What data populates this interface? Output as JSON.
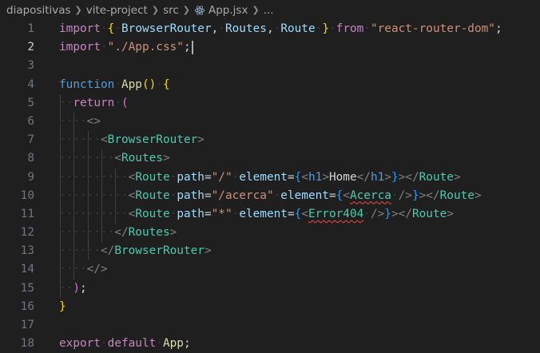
{
  "breadcrumb": {
    "segments": [
      "diapositivas",
      "vite-project",
      "src"
    ],
    "file": "App.jsx",
    "more": "..."
  },
  "editor": {
    "language": "javascriptreact",
    "active_line": 2,
    "cursor_line": 2,
    "error_lines": [
      10,
      11
    ],
    "lines": [
      {
        "n": "1",
        "tokens": [
          [
            "kw",
            "import"
          ],
          [
            "ws",
            "·"
          ],
          [
            "br1",
            "{"
          ],
          [
            "ws",
            "·"
          ],
          [
            "var",
            "BrowserRouter"
          ],
          [
            "op",
            ","
          ],
          [
            "ws",
            "·"
          ],
          [
            "var",
            "Routes"
          ],
          [
            "op",
            ","
          ],
          [
            "ws",
            "·"
          ],
          [
            "var",
            "Route"
          ],
          [
            "ws",
            "·"
          ],
          [
            "br1",
            "}"
          ],
          [
            "ws",
            "·"
          ],
          [
            "kw",
            "from"
          ],
          [
            "ws",
            "·"
          ],
          [
            "str",
            "\"react-router-dom\""
          ],
          [
            "op",
            ";"
          ]
        ]
      },
      {
        "n": "2",
        "tokens": [
          [
            "kw",
            "import"
          ],
          [
            "ws",
            "·"
          ],
          [
            "str",
            "\"./App.css\""
          ],
          [
            "op",
            ";"
          ]
        ]
      },
      {
        "n": "3",
        "tokens": []
      },
      {
        "n": "4",
        "tokens": [
          [
            "tagh",
            "function"
          ],
          [
            "ws",
            "·"
          ],
          [
            "fn",
            "App"
          ],
          [
            "br1",
            "()"
          ],
          [
            "ws",
            "·"
          ],
          [
            "br1",
            "{"
          ]
        ]
      },
      {
        "n": "5",
        "tokens": [
          [
            "ws",
            "··"
          ],
          [
            "kw",
            "return"
          ],
          [
            "ws",
            "·"
          ],
          [
            "br2",
            "("
          ]
        ]
      },
      {
        "n": "6",
        "tokens": [
          [
            "ws",
            "····"
          ],
          [
            "tagbr",
            "<>"
          ]
        ]
      },
      {
        "n": "7",
        "tokens": [
          [
            "ws",
            "······"
          ],
          [
            "tagbr",
            "<"
          ],
          [
            "tag",
            "BrowserRouter"
          ],
          [
            "tagbr",
            ">"
          ]
        ]
      },
      {
        "n": "8",
        "tokens": [
          [
            "ws",
            "········"
          ],
          [
            "tagbr",
            "<"
          ],
          [
            "tag",
            "Routes"
          ],
          [
            "tagbr",
            ">"
          ]
        ]
      },
      {
        "n": "9",
        "tokens": [
          [
            "ws",
            "··········"
          ],
          [
            "tagbr",
            "<"
          ],
          [
            "tag",
            "Route"
          ],
          [
            "ws",
            "·"
          ],
          [
            "attr",
            "path"
          ],
          [
            "op",
            "="
          ],
          [
            "str",
            "\"/\""
          ],
          [
            "ws",
            "·"
          ],
          [
            "attr",
            "element"
          ],
          [
            "op",
            "="
          ],
          [
            "br3",
            "{"
          ],
          [
            "tagbr",
            "<"
          ],
          [
            "tagh",
            "h1"
          ],
          [
            "tagbr",
            ">"
          ],
          [
            "txt",
            "Home"
          ],
          [
            "tagbr",
            "</"
          ],
          [
            "tagh",
            "h1"
          ],
          [
            "tagbr",
            ">"
          ],
          [
            "br3",
            "}"
          ],
          [
            "tagbr",
            "></"
          ],
          [
            "tag",
            "Route"
          ],
          [
            "tagbr",
            ">"
          ]
        ]
      },
      {
        "n": "10",
        "tokens": [
          [
            "ws",
            "··········"
          ],
          [
            "tagbr",
            "<"
          ],
          [
            "tag",
            "Route"
          ],
          [
            "ws",
            "·"
          ],
          [
            "attr",
            "path"
          ],
          [
            "op",
            "="
          ],
          [
            "str",
            "\"/acerca\""
          ],
          [
            "ws",
            "·"
          ],
          [
            "attr",
            "element"
          ],
          [
            "op",
            "="
          ],
          [
            "br3",
            "{"
          ],
          [
            "tagbr",
            "<"
          ],
          [
            "tag squig",
            "Acerca"
          ],
          [
            "ws",
            "·"
          ],
          [
            "tagbr",
            "/>"
          ],
          [
            "br3",
            "}"
          ],
          [
            "tagbr",
            "></"
          ],
          [
            "tag",
            "Route"
          ],
          [
            "tagbr",
            ">"
          ]
        ]
      },
      {
        "n": "11",
        "tokens": [
          [
            "ws",
            "··········"
          ],
          [
            "tagbr",
            "<"
          ],
          [
            "tag",
            "Route"
          ],
          [
            "ws",
            "·"
          ],
          [
            "attr",
            "path"
          ],
          [
            "op",
            "="
          ],
          [
            "str",
            "\"*\""
          ],
          [
            "ws",
            "·"
          ],
          [
            "attr",
            "element"
          ],
          [
            "op",
            "="
          ],
          [
            "br3",
            "{"
          ],
          [
            "tagbr",
            "<"
          ],
          [
            "tag squig",
            "Error404"
          ],
          [
            "ws",
            "·"
          ],
          [
            "tagbr",
            "/>"
          ],
          [
            "br3",
            "}"
          ],
          [
            "tagbr",
            "></"
          ],
          [
            "tag",
            "Route"
          ],
          [
            "tagbr",
            ">"
          ]
        ]
      },
      {
        "n": "12",
        "tokens": [
          [
            "ws",
            "········"
          ],
          [
            "tagbr",
            "</"
          ],
          [
            "tag",
            "Routes"
          ],
          [
            "tagbr",
            ">"
          ]
        ]
      },
      {
        "n": "13",
        "tokens": [
          [
            "ws",
            "······"
          ],
          [
            "tagbr",
            "</"
          ],
          [
            "tag",
            "BrowserRouter"
          ],
          [
            "tagbr",
            ">"
          ]
        ]
      },
      {
        "n": "14",
        "tokens": [
          [
            "ws",
            "····"
          ],
          [
            "tagbr",
            "</>"
          ]
        ]
      },
      {
        "n": "15",
        "tokens": [
          [
            "ws",
            "··"
          ],
          [
            "br2",
            ")"
          ],
          [
            "op",
            ";"
          ]
        ]
      },
      {
        "n": "16",
        "tokens": [
          [
            "br1",
            "}"
          ]
        ]
      },
      {
        "n": "17",
        "tokens": []
      },
      {
        "n": "18",
        "tokens": [
          [
            "kw",
            "export"
          ],
          [
            "ws",
            "·"
          ],
          [
            "kw",
            "default"
          ],
          [
            "ws",
            "·"
          ],
          [
            "fn",
            "App"
          ],
          [
            "op",
            ";"
          ]
        ]
      }
    ]
  }
}
